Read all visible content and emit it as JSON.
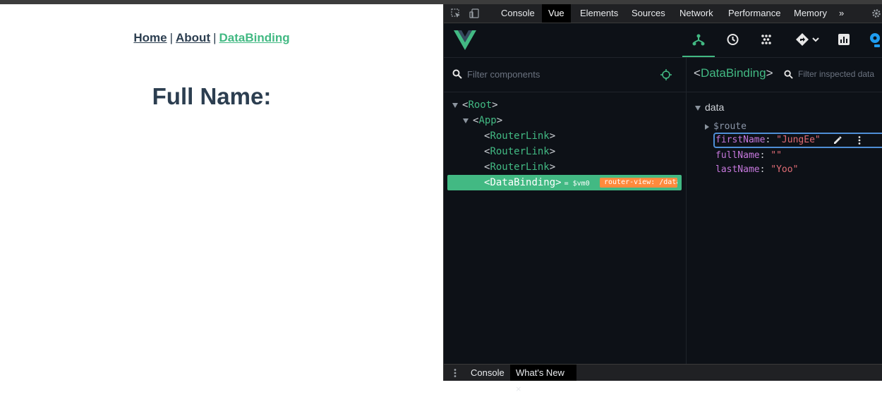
{
  "app": {
    "nav": [
      {
        "label": "Home"
      },
      {
        "label": "About"
      },
      {
        "label": "DataBinding"
      }
    ],
    "separator": "|",
    "heading": "Full Name:"
  },
  "devtools": {
    "tabs": [
      "Console",
      "Vue",
      "Elements",
      "Sources",
      "Network",
      "Performance",
      "Memory"
    ],
    "more": "»",
    "vue": {
      "filter_placeholder": "Filter components",
      "tree": [
        {
          "name": "Root"
        },
        {
          "name": "App"
        },
        {
          "name": "RouterLink"
        },
        {
          "name": "RouterLink"
        },
        {
          "name": "RouterLink"
        },
        {
          "name": "DataBinding",
          "vm": "= $vm0",
          "badge": "router-view: /datab"
        }
      ],
      "inspector": {
        "component": "DataBinding",
        "filter_placeholder": "Filter inspected data",
        "section": "data",
        "route": "$route",
        "fields": [
          {
            "key": "firstName",
            "value": "\"JungEe\""
          },
          {
            "key": "fullName",
            "value": "\"\""
          },
          {
            "key": "lastName",
            "value": "\"Yoo\""
          }
        ]
      }
    },
    "drawer_tabs": [
      "Console",
      "What's New"
    ],
    "drawer_close": "×"
  },
  "colors": {
    "vue_green": "#42b983",
    "badge_orange": "#ff8a3d",
    "text_dark": "#2c3e50"
  }
}
